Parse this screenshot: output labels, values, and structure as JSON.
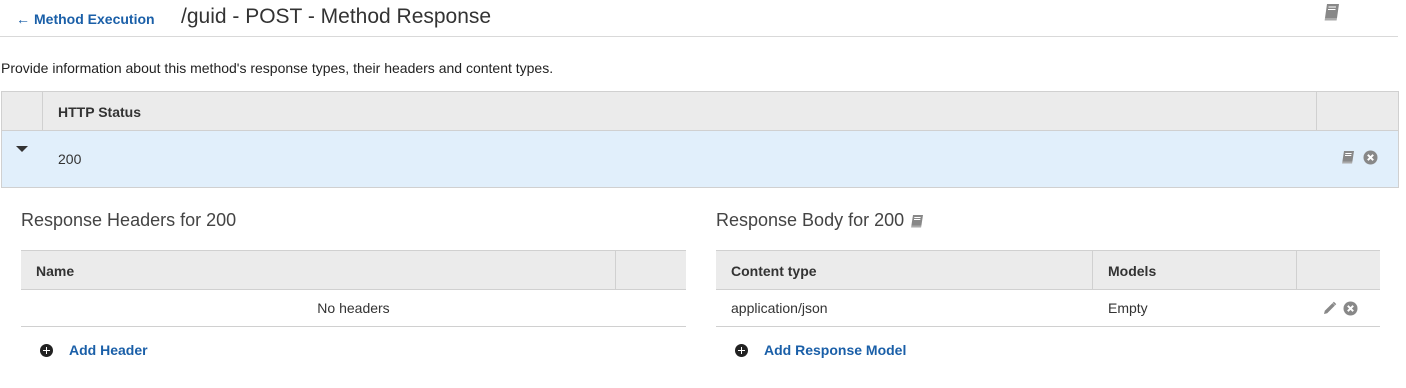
{
  "header": {
    "back_link_arrow": "←",
    "back_link_label": "Method Execution",
    "title": "/guid - POST - Method Response"
  },
  "description": "Provide information about this method's response types, their headers and content types.",
  "status_table": {
    "column_header": "HTTP Status",
    "rows": [
      {
        "status": "200"
      }
    ]
  },
  "headers_section": {
    "title": "Response Headers for 200",
    "columns": [
      "Name"
    ],
    "empty_message": "No headers",
    "add_label": "Add Header"
  },
  "body_section": {
    "title": "Response Body for 200",
    "columns": [
      "Content type",
      "Models"
    ],
    "rows": [
      {
        "content_type": "application/json",
        "model": "Empty"
      }
    ],
    "add_label": "Add Response Model"
  },
  "colors": {
    "link": "#1a5fa8",
    "selected_row": "#e1effb",
    "table_header": "#ebebeb",
    "border": "#d0d0d0"
  },
  "icons": [
    "arrow-left-icon",
    "book-icon",
    "close-circle-icon",
    "caret-down-icon",
    "pencil-icon",
    "plus-circle-icon"
  ]
}
